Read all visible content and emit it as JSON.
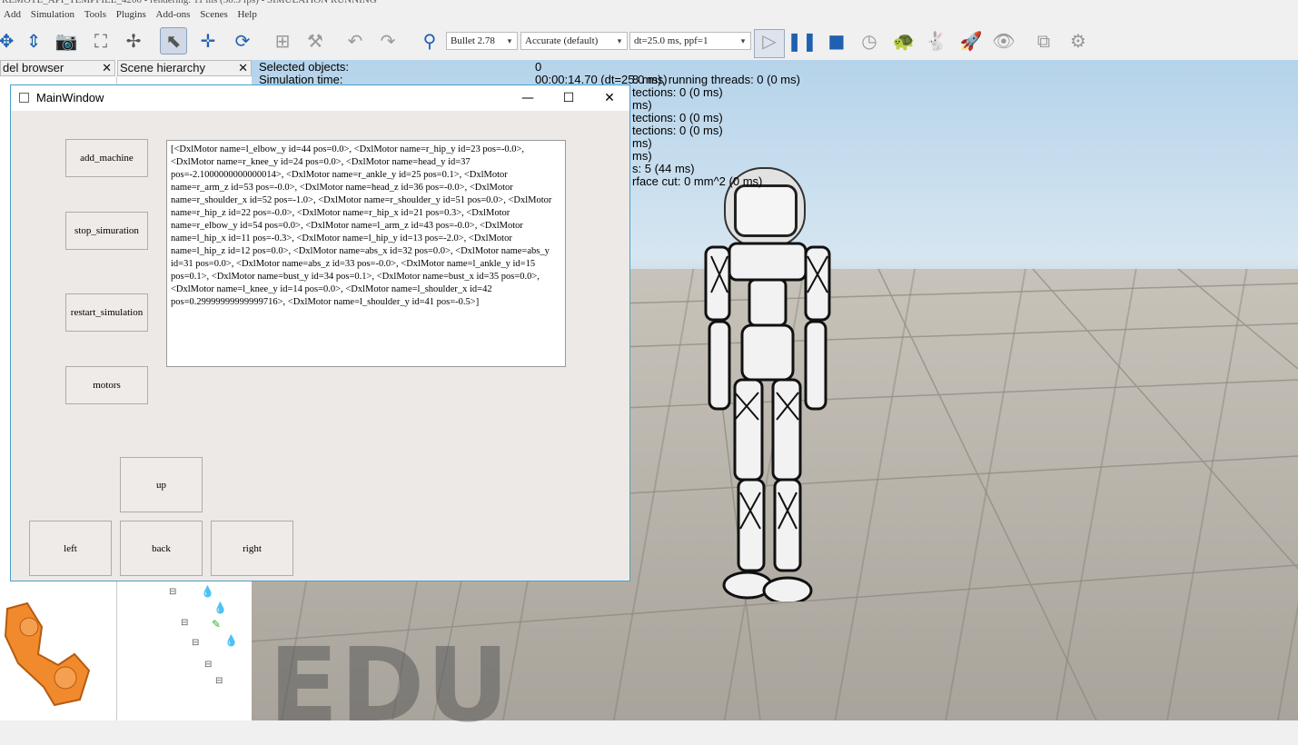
{
  "window_title": "REMOTE_API_TEMPFILE_4200 - rendering: 11 ms (30.3 fps) - SIMULATION RUNNING",
  "menu": [
    "Add",
    "Simulation",
    "Tools",
    "Plugins",
    "Add-ons",
    "Scenes",
    "Help"
  ],
  "toolbar": {
    "engine": "Bullet 2.78",
    "accuracy": "Accurate (default)",
    "timestep": "dt=25.0 ms, ppf=1"
  },
  "panels": {
    "model_browser_tab": "del browser",
    "scene_hierarchy_tab": "Scene hierarchy"
  },
  "stats": {
    "line1": "Selected objects:",
    "line1_value": "0",
    "line2": "Simulation time:",
    "line2_value": "00:00:14.70 (dt=25.0 ms)",
    "line3": "8 ms), running threads: 0 (0 ms)",
    "line4": "tections: 0 (0 ms)",
    "line5": "ms)",
    "line6": "tections: 0 (0 ms)",
    "line7": "tections: 0 (0 ms)",
    "line8": "ms)",
    "line9": "ms)",
    "line10": "s: 5 (44 ms)",
    "line11": "rface cut: 0 mm^2 (0 ms)"
  },
  "watermark": "EDU",
  "main_window": {
    "title": "MainWindow",
    "buttons": {
      "add_machine": "add_machine",
      "stop_simuration": "stop_simuration",
      "restart_simulation": "restart_simulation",
      "motors": "motors",
      "up": "up",
      "left": "left",
      "back": "back",
      "right": "right"
    },
    "output_text": "[<DxlMotor name=l_elbow_y id=44 pos=0.0>, <DxlMotor name=r_hip_y id=23 pos=-0.0>, <DxlMotor name=r_knee_y id=24 pos=0.0>, <DxlMotor name=head_y id=37 pos=-2.1000000000000014>, <DxlMotor name=r_ankle_y id=25 pos=0.1>, <DxlMotor name=r_arm_z id=53 pos=-0.0>, <DxlMotor name=head_z id=36 pos=-0.0>, <DxlMotor name=r_shoulder_x id=52 pos=-1.0>, <DxlMotor name=r_shoulder_y id=51 pos=0.0>, <DxlMotor name=r_hip_z id=22 pos=-0.0>, <DxlMotor name=r_hip_x id=21 pos=0.3>, <DxlMotor name=r_elbow_y id=54 pos=0.0>, <DxlMotor name=l_arm_z id=43 pos=-0.0>, <DxlMotor name=l_hip_x id=11 pos=-0.3>, <DxlMotor name=l_hip_y id=13 pos=-2.0>, <DxlMotor name=l_hip_z id=12 pos=0.0>, <DxlMotor name=abs_x id=32 pos=0.0>, <DxlMotor name=abs_y id=31 pos=0.0>, <DxlMotor name=abs_z id=33 pos=-0.0>, <DxlMotor name=l_ankle_y id=15 pos=0.1>, <DxlMotor name=bust_y id=34 pos=0.1>, <DxlMotor name=bust_x id=35 pos=0.0>, <DxlMotor name=l_knee_y id=14 pos=0.0>, <DxlMotor name=l_shoulder_x id=42 pos=0.29999999999999716>, <DxlMotor name=l_shoulder_y id=41 pos=-0.5>]"
  }
}
